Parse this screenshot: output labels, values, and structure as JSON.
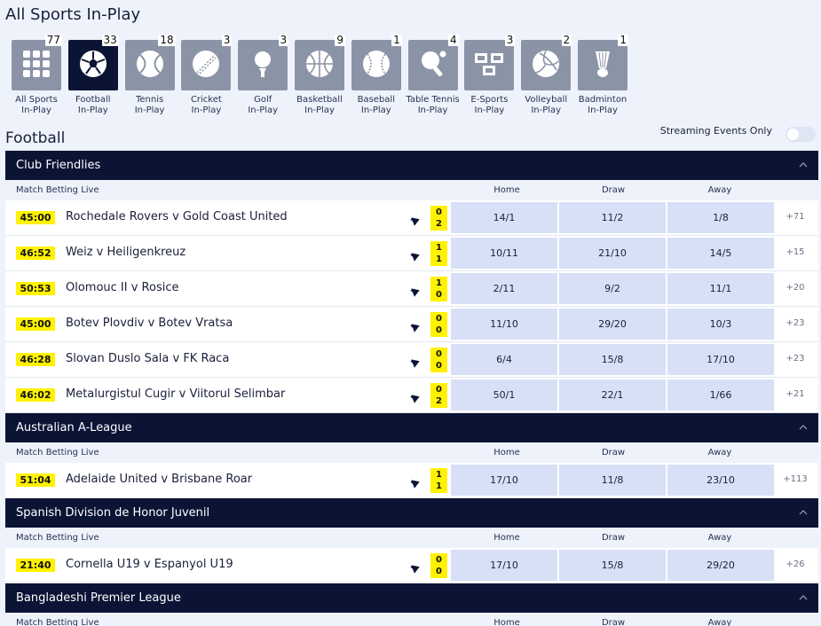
{
  "page_title": "All Sports In-Play",
  "sports": [
    {
      "name": "All Sports",
      "sub": "In-Play",
      "count": "77",
      "icon": "grid-icon",
      "active": false
    },
    {
      "name": "Football",
      "sub": "In-Play",
      "count": "33",
      "icon": "football-icon",
      "active": true
    },
    {
      "name": "Tennis",
      "sub": "In-Play",
      "count": "18",
      "icon": "tennis-icon",
      "active": false
    },
    {
      "name": "Cricket",
      "sub": "In-Play",
      "count": "3",
      "icon": "cricket-icon",
      "active": false
    },
    {
      "name": "Golf",
      "sub": "In-Play",
      "count": "3",
      "icon": "golf-icon",
      "active": false
    },
    {
      "name": "Basketball",
      "sub": "In-Play",
      "count": "9",
      "icon": "basketball-icon",
      "active": false
    },
    {
      "name": "Baseball",
      "sub": "In-Play",
      "count": "1",
      "icon": "baseball-icon",
      "active": false
    },
    {
      "name": "Table Tennis",
      "sub": "In-Play",
      "count": "4",
      "icon": "table-tennis-icon",
      "active": false
    },
    {
      "name": "E-Sports",
      "sub": "In-Play",
      "count": "3",
      "icon": "esports-icon",
      "active": false
    },
    {
      "name": "Volleyball",
      "sub": "In-Play",
      "count": "2",
      "icon": "volleyball-icon",
      "active": false
    },
    {
      "name": "Badminton",
      "sub": "In-Play",
      "count": "1",
      "icon": "badminton-icon",
      "active": false
    }
  ],
  "section_title": "Football",
  "streaming_label": "Streaming Events Only",
  "market_label": "Match Betting Live",
  "columns": {
    "home": "Home",
    "draw": "Draw",
    "away": "Away"
  },
  "colors": {
    "navy": "#0b1435",
    "yellow": "#fff200",
    "odds_bg": "#d7e0f6",
    "tile_grey": "#8b94a7"
  },
  "competitions": [
    {
      "name": "Club Friendlies",
      "matches": [
        {
          "time": "45:00",
          "teams": "Rochedale Rovers v Gold Coast United",
          "score_home": "0",
          "score_away": "2",
          "home": "14/1",
          "draw": "11/2",
          "away": "1/8",
          "more": "+71"
        },
        {
          "time": "46:52",
          "teams": "Weiz v Heiligenkreuz",
          "score_home": "1",
          "score_away": "1",
          "home": "10/11",
          "draw": "21/10",
          "away": "14/5",
          "more": "+15"
        },
        {
          "time": "50:53",
          "teams": "Olomouc II v Rosice",
          "score_home": "1",
          "score_away": "0",
          "home": "2/11",
          "draw": "9/2",
          "away": "11/1",
          "more": "+20"
        },
        {
          "time": "45:00",
          "teams": "Botev Plovdiv v Botev Vratsa",
          "score_home": "0",
          "score_away": "0",
          "home": "11/10",
          "draw": "29/20",
          "away": "10/3",
          "more": "+23"
        },
        {
          "time": "46:28",
          "teams": "Slovan Duslo Sala v FK Raca",
          "score_home": "0",
          "score_away": "0",
          "home": "6/4",
          "draw": "15/8",
          "away": "17/10",
          "more": "+23"
        },
        {
          "time": "46:02",
          "teams": "Metalurgistul Cugir v Viitorul Selimbar",
          "score_home": "0",
          "score_away": "2",
          "home": "50/1",
          "draw": "22/1",
          "away": "1/66",
          "more": "+21"
        }
      ]
    },
    {
      "name": "Australian A-League",
      "matches": [
        {
          "time": "51:04",
          "teams": "Adelaide United v Brisbane Roar",
          "score_home": "1",
          "score_away": "1",
          "home": "17/10",
          "draw": "11/8",
          "away": "23/10",
          "more": "+113"
        }
      ]
    },
    {
      "name": "Spanish Division de Honor Juvenil",
      "matches": [
        {
          "time": "21:40",
          "teams": "Cornella U19 v Espanyol U19",
          "score_home": "0",
          "score_away": "0",
          "home": "17/10",
          "draw": "15/8",
          "away": "29/20",
          "more": "+26"
        }
      ]
    },
    {
      "name": "Bangladeshi Premier League",
      "matches": []
    }
  ]
}
